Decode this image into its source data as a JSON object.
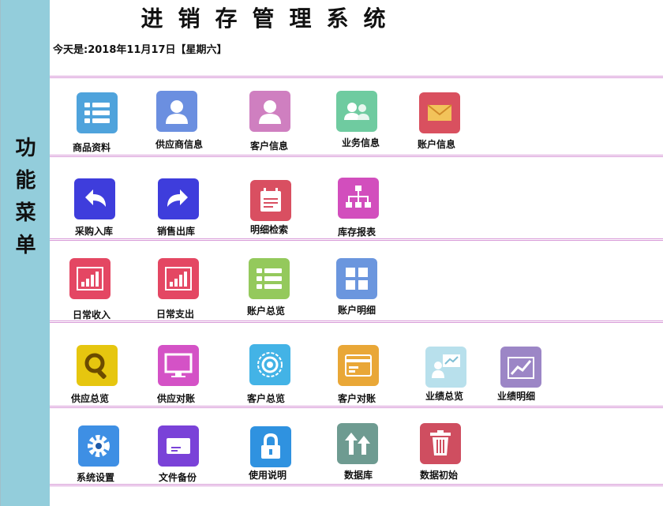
{
  "app": {
    "title": "进销存管理系统",
    "date_text": "今天是:2018年11月17日【星期六】",
    "sidebar_title": [
      "功",
      "能",
      "菜",
      "单"
    ]
  },
  "menu": [
    {
      "label": "商品资料",
      "icon": "list-icon",
      "color": "#4fa3dc"
    },
    {
      "label": "供应商信息",
      "icon": "user-icon",
      "color": "#6b8fe0"
    },
    {
      "label": "客户信息",
      "icon": "user-icon",
      "color": "#cf7fc0"
    },
    {
      "label": "业务信息",
      "icon": "users-icon",
      "color": "#6fcba0"
    },
    {
      "label": "账户信息",
      "icon": "mail-icon",
      "color": "#d9505f"
    },
    {
      "label": "采购入库",
      "icon": "undo-icon",
      "color": "#3e3ddc"
    },
    {
      "label": "销售出库",
      "icon": "redo-icon",
      "color": "#3e3ddc"
    },
    {
      "label": "明细检索",
      "icon": "calendar-icon",
      "color": "#d94f61"
    },
    {
      "label": "库存报表",
      "icon": "hierarchy-icon",
      "color": "#d24ebd"
    },
    {
      "label": "日常收入",
      "icon": "bar-chart-icon",
      "color": "#e44763"
    },
    {
      "label": "日常支出",
      "icon": "bar-chart-icon",
      "color": "#e44763"
    },
    {
      "label": "账户总览",
      "icon": "list-icon",
      "color": "#94c95c"
    },
    {
      "label": "账户明细",
      "icon": "grid-icon",
      "color": "#6b96de"
    },
    {
      "label": "供应总览",
      "icon": "search-icon",
      "color": "#e6c60f"
    },
    {
      "label": "供应对账",
      "icon": "monitor-icon",
      "color": "#d452c6"
    },
    {
      "label": "客户总览",
      "icon": "target-icon",
      "color": "#43b3e6"
    },
    {
      "label": "客户对账",
      "icon": "card-icon",
      "color": "#e9a737"
    },
    {
      "label": "业绩总览",
      "icon": "presenter-icon",
      "color": "#b8e0ec"
    },
    {
      "label": "业绩明细",
      "icon": "trend-icon",
      "color": "#9c86c6"
    },
    {
      "label": "系统设置",
      "icon": "gear-icon",
      "color": "#3e8fe4"
    },
    {
      "label": "文件备份",
      "icon": "envelope-icon",
      "color": "#7a42d8"
    },
    {
      "label": "使用说明",
      "icon": "lock-icon",
      "color": "#2f92e0"
    },
    {
      "label": "数据库",
      "icon": "upload-icon",
      "color": "#6e9b91"
    },
    {
      "label": "数据初始",
      "icon": "trash-icon",
      "color": "#cf4e60"
    }
  ]
}
